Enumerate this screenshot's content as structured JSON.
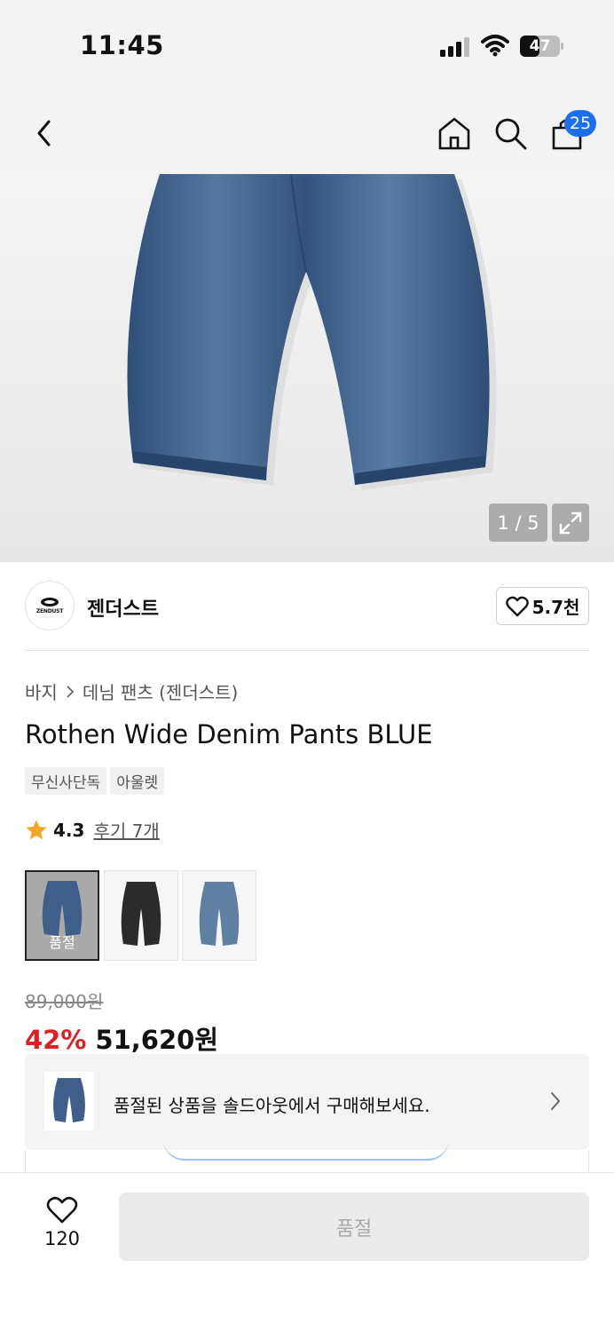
{
  "status_bar": {
    "time": "11:45",
    "battery": "47"
  },
  "header": {
    "cart_count": "25"
  },
  "gallery": {
    "pager": "1 / 5"
  },
  "brand": {
    "logo_text": "ZENDUST",
    "name": "젠더스트",
    "likes": "5.7천"
  },
  "breadcrumb": {
    "level1": "바지",
    "level2": "데님 팬츠 (젠더스트)"
  },
  "product": {
    "title": "Rothen Wide Denim Pants BLUE",
    "tags": [
      "무신사단독",
      "아울렛"
    ],
    "rating": "4.3",
    "reviews": "후기 7개"
  },
  "swatches": [
    {
      "color": "#3f5f8a",
      "soldout": "품절",
      "selected": true
    },
    {
      "color": "#2b2b2b",
      "selected": false
    },
    {
      "color": "#5f7fa3",
      "selected": false
    }
  ],
  "price": {
    "original": "89,000원",
    "discount": "42%",
    "final": "51,620원"
  },
  "banner": {
    "text": "품절된 상품을 솔드아웃에서 구매해보세요."
  },
  "bottom_bar": {
    "wish_count": "120",
    "buy_label": "품절"
  }
}
